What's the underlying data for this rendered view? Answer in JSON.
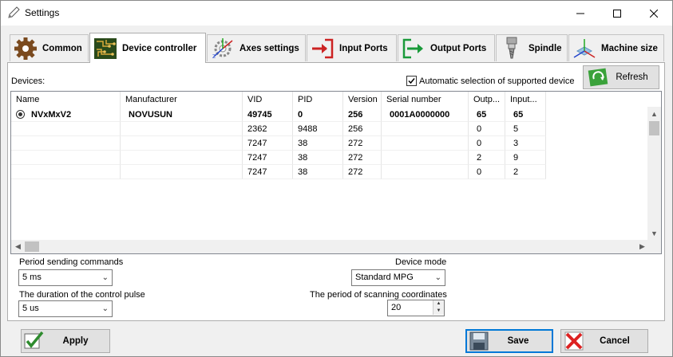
{
  "window": {
    "title": "Settings"
  },
  "tabs": [
    {
      "label": "Common",
      "icon": "gear-icon"
    },
    {
      "label": "Device controller",
      "icon": "circuit-board-icon"
    },
    {
      "label": "Axes settings",
      "icon": "axes-gear-icon"
    },
    {
      "label": "Input Ports",
      "icon": "input-arrow-icon"
    },
    {
      "label": "Output Ports",
      "icon": "output-arrow-icon"
    },
    {
      "label": "Spindle",
      "icon": "spindle-icon"
    },
    {
      "label": "Machine size",
      "icon": "machine-size-icon"
    }
  ],
  "devices": {
    "label": "Devices:",
    "auto_select_label": "Automatic selection of supported device",
    "auto_select_checked": true,
    "refresh_label": "Refresh",
    "columns": [
      "Name",
      "Manufacturer",
      "VID",
      "PID",
      "Version",
      "Serial number",
      "Outp...",
      "Input..."
    ],
    "rows": [
      [
        "NVxMxV2",
        "NOVUSUN",
        "49745",
        "0",
        "256",
        "0001A0000000",
        "65",
        "65"
      ],
      [
        "",
        "",
        "2362",
        "9488",
        "256",
        "",
        "0",
        "5"
      ],
      [
        "",
        "",
        "7247",
        "38",
        "272",
        "",
        "0",
        "3"
      ],
      [
        "",
        "",
        "7247",
        "38",
        "272",
        "",
        "2",
        "9"
      ],
      [
        "",
        "",
        "7247",
        "38",
        "272",
        "",
        "0",
        "2"
      ]
    ]
  },
  "form": {
    "period_label": "Period sending commands",
    "period_value": "5 ms",
    "pulse_label": "The duration of the control pulse",
    "pulse_value": "5 us",
    "mode_label": "Device mode",
    "mode_value": "Standard MPG",
    "scan_label": "The period of scanning coordinates",
    "scan_value": "20"
  },
  "buttons": {
    "apply": "Apply",
    "save": "Save",
    "cancel": "Cancel"
  }
}
